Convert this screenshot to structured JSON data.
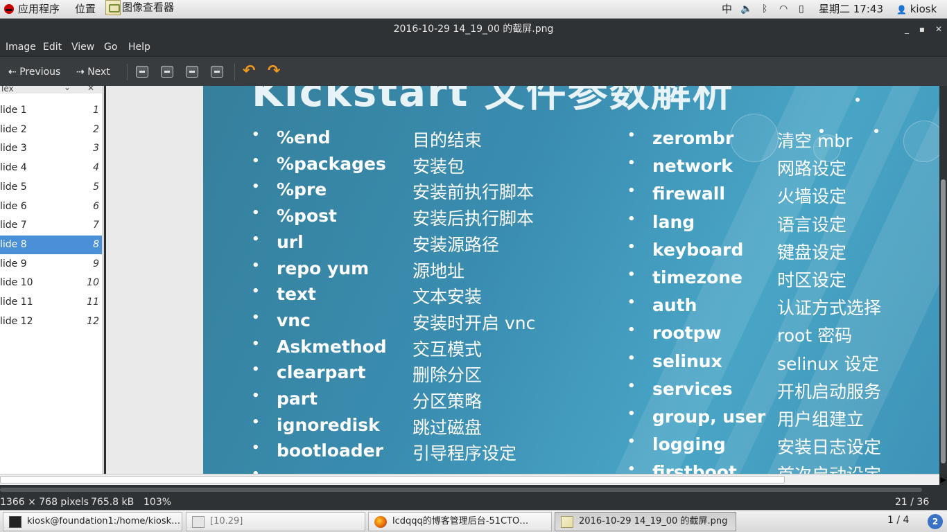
{
  "top_panel": {
    "applications": "应用程序",
    "places": "位置",
    "app_name": "图像查看器",
    "input_method": "中",
    "datetime": "星期二 17:43",
    "user": "kiosk"
  },
  "window": {
    "title": "2016-10-29 14_19_00 的截屏.png"
  },
  "menu": [
    "Image",
    "Edit",
    "View",
    "Go",
    "Help"
  ],
  "toolbar": {
    "previous": "Previous",
    "next": "Next"
  },
  "sidebar": {
    "header": "lex",
    "slides": [
      {
        "label": "lide 1",
        "num": "1"
      },
      {
        "label": "lide 2",
        "num": "2"
      },
      {
        "label": "lide 3",
        "num": "3"
      },
      {
        "label": "lide 4",
        "num": "4"
      },
      {
        "label": "lide 5",
        "num": "5"
      },
      {
        "label": "lide 6",
        "num": "6"
      },
      {
        "label": "lide 7",
        "num": "7"
      },
      {
        "label": "lide 8",
        "num": "8"
      },
      {
        "label": "lide 9",
        "num": "9"
      },
      {
        "label": "lide 10",
        "num": "10"
      },
      {
        "label": "lide 11",
        "num": "11"
      },
      {
        "label": "lide 12",
        "num": "12"
      }
    ],
    "selected_index": 7
  },
  "slide": {
    "title": "Kickstart 文件参数解析",
    "left": [
      {
        "key": "%end",
        "value": "目的结束"
      },
      {
        "key": "%packages",
        "value": "安装包"
      },
      {
        "key": "%pre",
        "value": "安装前执行脚本"
      },
      {
        "key": "%post",
        "value": "安装后执行脚本"
      },
      {
        "key": "url",
        "value": "安装源路径"
      },
      {
        "key": "repo yum",
        "value": "源地址"
      },
      {
        "key": "text",
        "value": "文本安装"
      },
      {
        "key": "vnc",
        "value": "安装时开启 vnc"
      },
      {
        "key": "Askmethod",
        "value": "交互模式"
      },
      {
        "key": "clearpart",
        "value": "删除分区"
      },
      {
        "key": "part",
        "value": "分区策略"
      },
      {
        "key": "ignoredisk",
        "value": "跳过磁盘"
      },
      {
        "key": "bootloader",
        "value": "引导程序设定"
      },
      {
        "key": "",
        "value": ""
      }
    ],
    "right": [
      {
        "key": "zerombr",
        "value": "清空 mbr"
      },
      {
        "key": "network",
        "value": "网路设定"
      },
      {
        "key": "firewall",
        "value": "火墙设定"
      },
      {
        "key": "lang",
        "value": "语言设定"
      },
      {
        "key": "keyboard",
        "value": "键盘设定"
      },
      {
        "key": "timezone",
        "value": "时区设定"
      },
      {
        "key": "auth",
        "value": "认证方式选择"
      },
      {
        "key": "rootpw",
        "value": "root 密码"
      },
      {
        "key": "selinux",
        "value": "selinux 设定"
      },
      {
        "key": "services",
        "value": "开机启动服务"
      },
      {
        "key": "group, user",
        "value": "用户组建立"
      },
      {
        "key": "logging",
        "value": "安装日志设定"
      },
      {
        "key": "firstboot",
        "value": "首次启动设定"
      }
    ]
  },
  "status": {
    "dimensions": "1366 × 768 pixels",
    "size": "765.8 kB",
    "zoom": "103%",
    "position": "21 / 36"
  },
  "taskbar": {
    "tasks": [
      {
        "label": "kiosk@foundation1:/home/kiosk…",
        "icon": "terminal-icon"
      },
      {
        "label": "[10.29]",
        "icon": "window-icon"
      },
      {
        "label": "lcdqqq的博客管理后台-51CTO…",
        "icon": "firefox-icon"
      },
      {
        "label": "2016-10-29 14_19_00 的截屏.png",
        "icon": "image-viewer-icon"
      }
    ],
    "workspace": "1 / 4",
    "notifications": "2"
  }
}
